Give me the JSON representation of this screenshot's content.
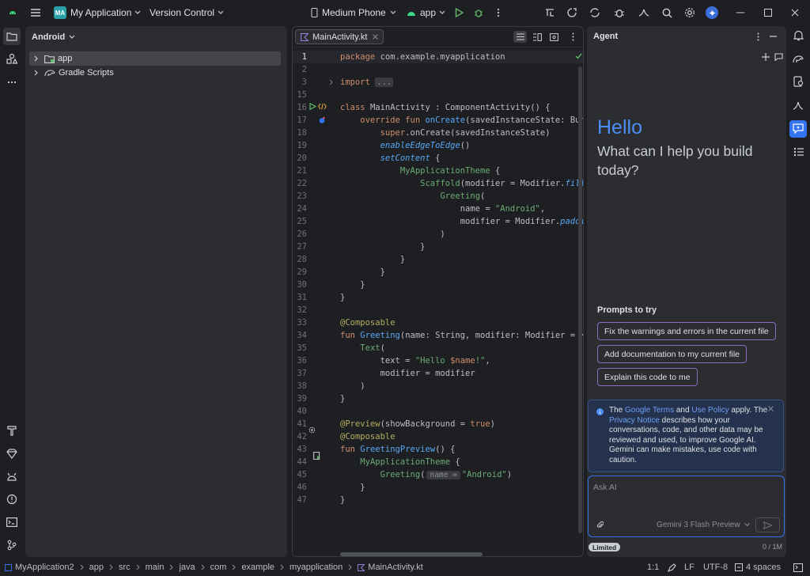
{
  "titlebar": {
    "project_badge": "MA",
    "project_name": "My Application",
    "vcs": "Version Control",
    "device": "Medium Phone",
    "run_config": "app"
  },
  "project": {
    "view_selector": "Android",
    "items": [
      {
        "label": "app",
        "icon": "module-folder-icon"
      },
      {
        "label": "Gradle Scripts",
        "icon": "gradle-icon"
      }
    ]
  },
  "editor": {
    "tab": "MainActivity.kt",
    "lines": [
      {
        "n": "1",
        "t": [
          [
            "kw",
            "package "
          ],
          [
            "cl",
            "com.example.myapplication"
          ]
        ]
      },
      {
        "n": "2",
        "t": []
      },
      {
        "n": "3",
        "t": [
          [
            "kw",
            "import "
          ],
          [
            "fold",
            "..."
          ]
        ]
      },
      {
        "n": "15",
        "t": []
      },
      {
        "n": "16",
        "t": [
          [
            "kw",
            "class "
          ],
          [
            "cl",
            "MainActivity : ComponentActivity() {"
          ]
        ]
      },
      {
        "n": "17",
        "t": [
          [
            "cl",
            "    "
          ],
          [
            "kw",
            "override fun "
          ],
          [
            "fn",
            "onCreate"
          ],
          [
            "cl",
            "(savedInstanceState: Bundle"
          ]
        ]
      },
      {
        "n": "18",
        "t": [
          [
            "cl",
            "        "
          ],
          [
            "kw",
            "super"
          ],
          [
            "cl",
            ".onCreate(savedInstanceState)"
          ]
        ]
      },
      {
        "n": "19",
        "t": [
          [
            "cl",
            "        "
          ],
          [
            "it",
            "enableEdgeToEdge"
          ],
          [
            "cl",
            "()"
          ]
        ]
      },
      {
        "n": "20",
        "t": [
          [
            "cl",
            "        "
          ],
          [
            "it",
            "setContent"
          ],
          [
            "cl",
            " {"
          ]
        ]
      },
      {
        "n": "21",
        "t": [
          [
            "cl",
            "            "
          ],
          [
            "str2",
            "MyApplicationTheme"
          ],
          [
            "cl",
            " {"
          ]
        ]
      },
      {
        "n": "22",
        "t": [
          [
            "cl",
            "                "
          ],
          [
            "str2",
            "Scaffold"
          ],
          [
            "cl",
            "(modifier = Modifier."
          ],
          [
            "it",
            "fillMax"
          ]
        ]
      },
      {
        "n": "23",
        "t": [
          [
            "cl",
            "                    "
          ],
          [
            "str2",
            "Greeting"
          ],
          [
            "cl",
            "("
          ]
        ]
      },
      {
        "n": "24",
        "t": [
          [
            "cl",
            "                        name = "
          ],
          [
            "str",
            "\"Android\""
          ],
          [
            "cl",
            ","
          ]
        ]
      },
      {
        "n": "25",
        "t": [
          [
            "cl",
            "                        modifier = Modifier."
          ],
          [
            "it",
            "padding"
          ],
          [
            "cl",
            "("
          ]
        ]
      },
      {
        "n": "26",
        "t": [
          [
            "cl",
            "                    )"
          ]
        ]
      },
      {
        "n": "27",
        "t": [
          [
            "cl",
            "                }"
          ]
        ]
      },
      {
        "n": "28",
        "t": [
          [
            "cl",
            "            }"
          ]
        ]
      },
      {
        "n": "29",
        "t": [
          [
            "cl",
            "        }"
          ]
        ]
      },
      {
        "n": "30",
        "t": [
          [
            "cl",
            "    }"
          ]
        ]
      },
      {
        "n": "31",
        "t": [
          [
            "cl",
            "}"
          ]
        ]
      },
      {
        "n": "32",
        "t": []
      },
      {
        "n": "33",
        "t": [
          [
            "ann",
            "@Composable"
          ]
        ]
      },
      {
        "n": "34",
        "t": [
          [
            "kw",
            "fun "
          ],
          [
            "fn",
            "Greeting"
          ],
          [
            "cl",
            "(name: String, modifier: Modifier = Modi"
          ]
        ]
      },
      {
        "n": "35",
        "t": [
          [
            "cl",
            "    "
          ],
          [
            "str2",
            "Text"
          ],
          [
            "cl",
            "("
          ]
        ]
      },
      {
        "n": "36",
        "t": [
          [
            "cl",
            "        text = "
          ],
          [
            "str",
            "\"Hello "
          ],
          [
            "kw",
            "$name"
          ],
          [
            "str",
            "!\""
          ],
          [
            "cl",
            ","
          ]
        ]
      },
      {
        "n": "37",
        "t": [
          [
            "cl",
            "        modifier = modifier"
          ]
        ]
      },
      {
        "n": "38",
        "t": [
          [
            "cl",
            "    )"
          ]
        ]
      },
      {
        "n": "39",
        "t": [
          [
            "cl",
            "}"
          ]
        ]
      },
      {
        "n": "40",
        "t": []
      },
      {
        "n": "41",
        "t": [
          [
            "ann",
            "@Preview"
          ],
          [
            "cl",
            "(showBackground = "
          ],
          [
            "kw",
            "true"
          ],
          [
            "cl",
            ")"
          ]
        ]
      },
      {
        "n": "42",
        "t": [
          [
            "ann",
            "@Composable"
          ]
        ]
      },
      {
        "n": "43",
        "t": [
          [
            "kw",
            "fun "
          ],
          [
            "fn",
            "GreetingPreview"
          ],
          [
            "cl",
            "() {"
          ]
        ]
      },
      {
        "n": "44",
        "t": [
          [
            "cl",
            "    "
          ],
          [
            "str2",
            "MyApplicationTheme"
          ],
          [
            "cl",
            " {"
          ]
        ]
      },
      {
        "n": "45",
        "t": [
          [
            "cl",
            "        "
          ],
          [
            "str2",
            "Greeting"
          ],
          [
            "cl",
            "("
          ],
          [
            "hint",
            "name ="
          ],
          [
            "str",
            "\"Android\""
          ],
          [
            "cl",
            ")"
          ]
        ]
      },
      {
        "n": "46",
        "t": [
          [
            "cl",
            "    }"
          ]
        ]
      },
      {
        "n": "47",
        "t": [
          [
            "cl",
            "}"
          ]
        ]
      }
    ]
  },
  "agent": {
    "title": "Agent",
    "greeting": "Hello",
    "subtitle": "What can I help you build today?",
    "prompts_title": "Prompts to try",
    "prompts": [
      "Fix the warnings and errors in the current file",
      "Add documentation to my current file",
      "Explain this code to me"
    ],
    "notice": {
      "p1": "The ",
      "link1": "Google Terms",
      "p2": " and ",
      "link2": "Use Policy",
      "p3": " apply. The ",
      "link3": "Privacy Notice",
      "p4": " describes how your conversations, code, and other data may be reviewed and used, to improve Google AI. Gemini can make mistakes, use code with caution."
    },
    "input_placeholder": "Ask AI",
    "model": "Gemini 3 Flash Preview",
    "badge": "Limited",
    "quota": "0 / 1M"
  },
  "statusbar": {
    "breadcrumbs": [
      "MyApplication2",
      "app",
      "src",
      "main",
      "java",
      "com",
      "example",
      "myapplication",
      "MainActivity.kt"
    ],
    "position": "1:1",
    "line_sep": "LF",
    "encoding": "UTF-8",
    "indent": "4 spaces"
  },
  "colors": {
    "accent": "#3574f0",
    "gemini_blue": "#4c8df6",
    "prompt_border": "#8a6dbe",
    "notice_bg": "#25324d"
  }
}
